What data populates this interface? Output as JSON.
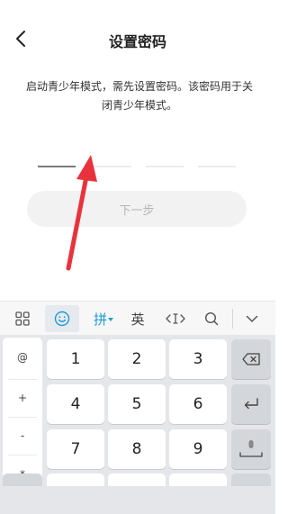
{
  "header": {
    "title": "设置密码",
    "back_icon": "chevron-left-icon"
  },
  "description": "启动青少年模式，需先设置密码。该密码用于关闭青少年模式。",
  "password": {
    "slots": 4,
    "active_slot": 1
  },
  "next_button": {
    "label": "下一步"
  },
  "ime_toolbar": {
    "items": [
      {
        "name": "grid-icon"
      },
      {
        "name": "emoji-icon"
      },
      {
        "name": "pinyin-label",
        "label": "拼"
      },
      {
        "name": "english-label",
        "label": "英"
      },
      {
        "name": "cursor-move-icon"
      },
      {
        "name": "search-icon"
      },
      {
        "name": "collapse-keyboard-icon"
      }
    ],
    "accent": "#1f9bd6"
  },
  "keyboard": {
    "side_keys": [
      "@",
      "+",
      "-",
      "*"
    ],
    "digits": [
      "1",
      "2",
      "3",
      "4",
      "5",
      "6",
      "7",
      "8",
      "9"
    ],
    "function_keys": [
      "backspace-icon",
      "enter-icon",
      "mic-space-icon"
    ]
  },
  "annotation": {
    "type": "red-arrow",
    "color": "#e8333c"
  }
}
